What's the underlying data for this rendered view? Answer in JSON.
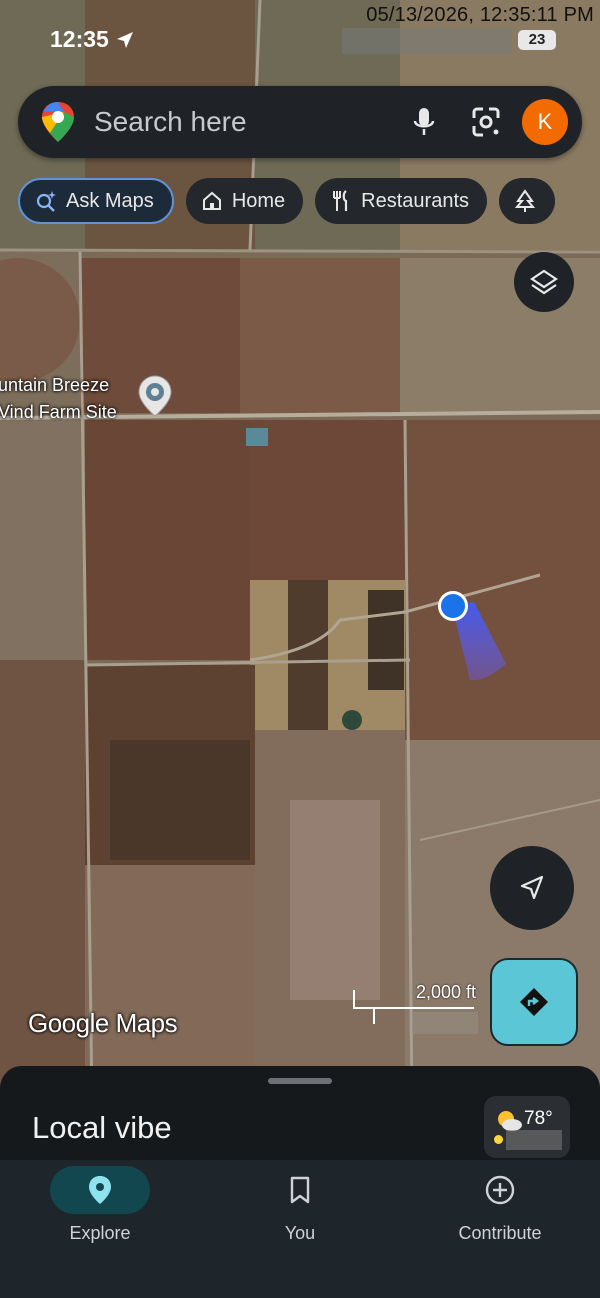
{
  "overlay": {
    "timestamp": "05/13/2026, 12:35:11 PM"
  },
  "status_bar": {
    "time": "12:35",
    "battery": "23"
  },
  "search": {
    "placeholder": "Search here",
    "avatar_initial": "K"
  },
  "chips": [
    {
      "label": "Ask Maps",
      "icon": "sparkle-search-icon"
    },
    {
      "label": "Home",
      "icon": "home-icon"
    },
    {
      "label": "Restaurants",
      "icon": "fork-knife-icon"
    },
    {
      "label": "",
      "icon": "tree-icon"
    }
  ],
  "map": {
    "place_label_line1": "untain Breeze",
    "place_label_line2": "Vind Farm Site",
    "scale_label": "2,000 ft",
    "attribution": "Google Maps"
  },
  "sheet": {
    "title": "Local vibe",
    "weather_temp": "78°"
  },
  "navbar": {
    "items": [
      {
        "label": "Explore",
        "icon": "pin-icon",
        "active": true
      },
      {
        "label": "You",
        "icon": "bookmark-icon",
        "active": false
      },
      {
        "label": "Contribute",
        "icon": "plus-circle-icon",
        "active": false
      }
    ]
  },
  "colors": {
    "accent_teal": "#5bc6d6",
    "avatar_orange": "#f26a00",
    "user_location_blue": "#1a73e8"
  }
}
